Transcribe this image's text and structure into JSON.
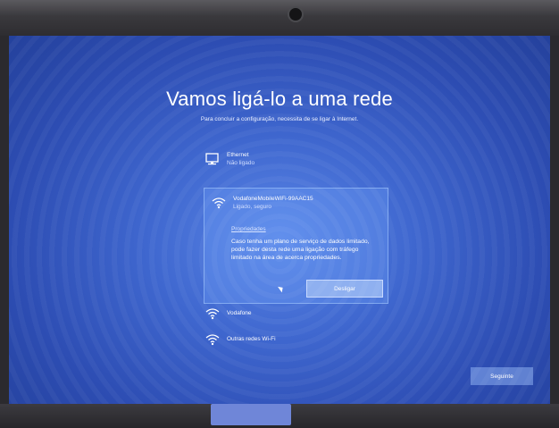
{
  "page": {
    "title": "Vamos ligá-lo a uma rede",
    "subtitle": "Para concluir a configuração, necessita de se ligar à Internet."
  },
  "networks": [
    {
      "name": "Ethernet",
      "status": "Não ligado",
      "icon": "ethernet-icon"
    },
    {
      "name": "VodafoneMobileWiFi-99AAC15",
      "status": "Ligado, seguro",
      "icon": "wifi-icon",
      "selected": true,
      "properties_label": "Propriedades",
      "description": "Caso tenha um plano de serviço de dados limitado, pode fazer desta rede uma ligação com tráfego limitado na área de acerca propriedades.",
      "action_label": "Desligar"
    },
    {
      "name": "Vodafone",
      "status": "",
      "icon": "wifi-icon"
    },
    {
      "name": "Outras redes Wi-Fi",
      "status": "",
      "icon": "wifi-icon"
    }
  ],
  "footer": {
    "next_label": "Seguinte"
  },
  "colors": {
    "accent": "#3f67cf",
    "selection": "#78aaff"
  }
}
